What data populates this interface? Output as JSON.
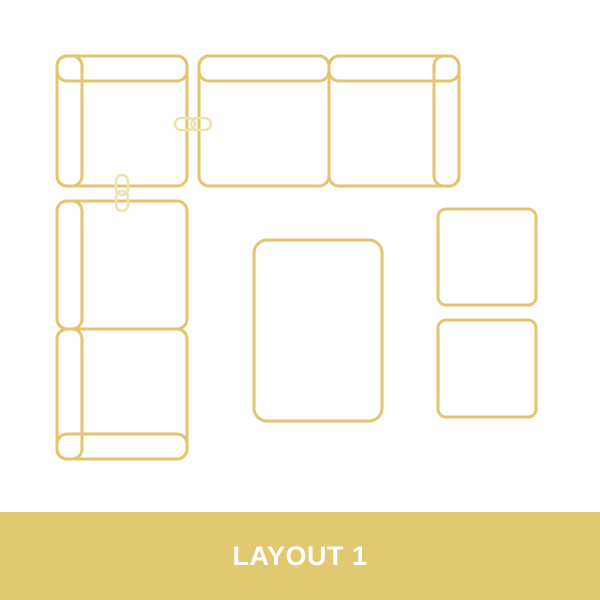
{
  "colors": {
    "line": "#e2c66f",
    "link": "#efe1b2",
    "background": "#ffffff",
    "footer_background": "#e3c872",
    "footer_text": "#ffffff"
  },
  "diagram": {
    "pieces": [
      "corner-seat-top-left",
      "middle-seat",
      "corner-seat-top-right",
      "armless-seat-left",
      "corner-seat-bottom-left",
      "coffee-table",
      "ottoman-top",
      "ottoman-bottom"
    ],
    "connectors": [
      "link-clip-horizontal",
      "link-clip-vertical"
    ]
  },
  "footer": {
    "label": "LAYOUT 1"
  }
}
